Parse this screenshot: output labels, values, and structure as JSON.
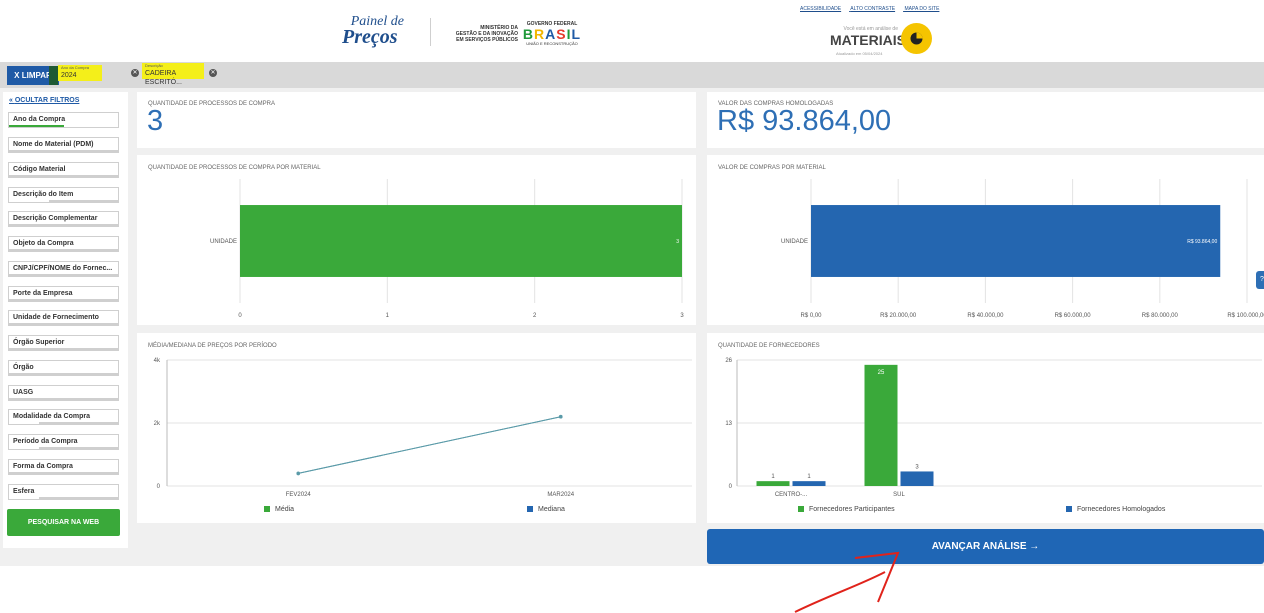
{
  "header": {
    "logo_line1": "Painel de",
    "logo_line2": "Preços",
    "ministry_lines": [
      "MINISTÉRIO DA",
      "GESTÃO E DA INOVAÇÃO",
      "EM SERVIÇOS PÚBLICOS"
    ],
    "gov_top": "GOVERNO FEDERAL",
    "gov_brasil": "BRASIL",
    "gov_sub": "UNIÃO E RECONSTRUÇÃO",
    "links": [
      "ACESSIBILIDADE",
      "ALTO CONTRASTE",
      "MAPA DO SITE"
    ],
    "analysis_note": "Você está em análise de",
    "analysis_title": "MATERIAIS",
    "updated": "Atualizado em 05/04/2024"
  },
  "filter_bar": {
    "clear_label": "X  LIMPAR",
    "chips": [
      {
        "label": "Ano da Compra",
        "value": "2024"
      },
      {
        "label": "Descrição",
        "value": "CADEIRA ESCRITÓ..."
      }
    ]
  },
  "sidebar": {
    "hide_label": "OCULTAR FILTROS",
    "filters": [
      "Ano da Compra",
      "Nome do Material (PDM)",
      "Código Material",
      "Descrição do Item",
      "Descrição Complementar",
      "Objeto da Compra",
      "CNPJ/CPF/NOME do Fornec...",
      "Porte da Empresa",
      "Unidade de Fornecimento",
      "Órgão Superior",
      "Órgão",
      "UASG",
      "Modalidade da Compra",
      "Período da Compra",
      "Forma da Compra",
      "Esfera"
    ],
    "search_web_label": "PESQUISAR NA WEB"
  },
  "kpis": {
    "processes_title": "QUANTIDADE DE PROCESSOS DE COMPRA",
    "processes_value": "3",
    "value_title": "VALOR DAS COMPRAS HOMOLOGADAS",
    "value_value": "R$ 93.864,00"
  },
  "chart_data": [
    {
      "type": "bar",
      "orientation": "horizontal",
      "title": "QUANTIDADE DE PROCESSOS DE COMPRA POR MATERIAL",
      "categories": [
        "UNIDADE"
      ],
      "values": [
        3
      ],
      "data_labels": [
        "3"
      ],
      "xlim": [
        0,
        3
      ],
      "x_ticks": [
        "0",
        "1",
        "2",
        "3"
      ],
      "color": "#3aa93a",
      "grid": true
    },
    {
      "type": "bar",
      "orientation": "horizontal",
      "title": "VALOR DE COMPRAS POR MATERIAL",
      "categories": [
        "UNIDADE"
      ],
      "values": [
        93864
      ],
      "data_labels": [
        "R$ 93.864,00"
      ],
      "xlim": [
        0,
        100000
      ],
      "x_ticks": [
        "R$ 0,00",
        "R$ 20.000,00",
        "R$ 40.000,00",
        "R$ 60.000,00",
        "R$ 80.000,00",
        "R$ 100.000,00"
      ],
      "color": "#2466b0",
      "grid": true
    },
    {
      "type": "line",
      "title": "MÉDIA/MEDIANA DE PREÇOS POR PERÍODO",
      "categories": [
        "FEV2024",
        "MAR2024"
      ],
      "series": [
        {
          "name": "Média",
          "values": [
            400,
            2200
          ],
          "color": "#3aa93a"
        },
        {
          "name": "Mediana",
          "values": [
            400,
            2200
          ],
          "color": "#2466b0"
        }
      ],
      "ylim": [
        0,
        4000
      ],
      "y_ticks": [
        "0",
        "2k",
        "4k"
      ],
      "line_color": "#5a9aa8",
      "legend": "bottom"
    },
    {
      "type": "bar",
      "title": "QUANTIDADE DE FORNECEDORES",
      "categories": [
        "CENTRO-...",
        "SUL"
      ],
      "series": [
        {
          "name": "Fornecedores Participantes",
          "values": [
            1,
            25
          ],
          "color": "#3aa93a"
        },
        {
          "name": "Fornecedores Homologados",
          "values": [
            1,
            3
          ],
          "color": "#2466b0"
        }
      ],
      "ylim": [
        0,
        26
      ],
      "y_ticks": [
        "0",
        "13",
        "26"
      ],
      "legend": "bottom"
    }
  ],
  "actions": {
    "advance_label": "AVANÇAR ANÁLISE  →"
  }
}
